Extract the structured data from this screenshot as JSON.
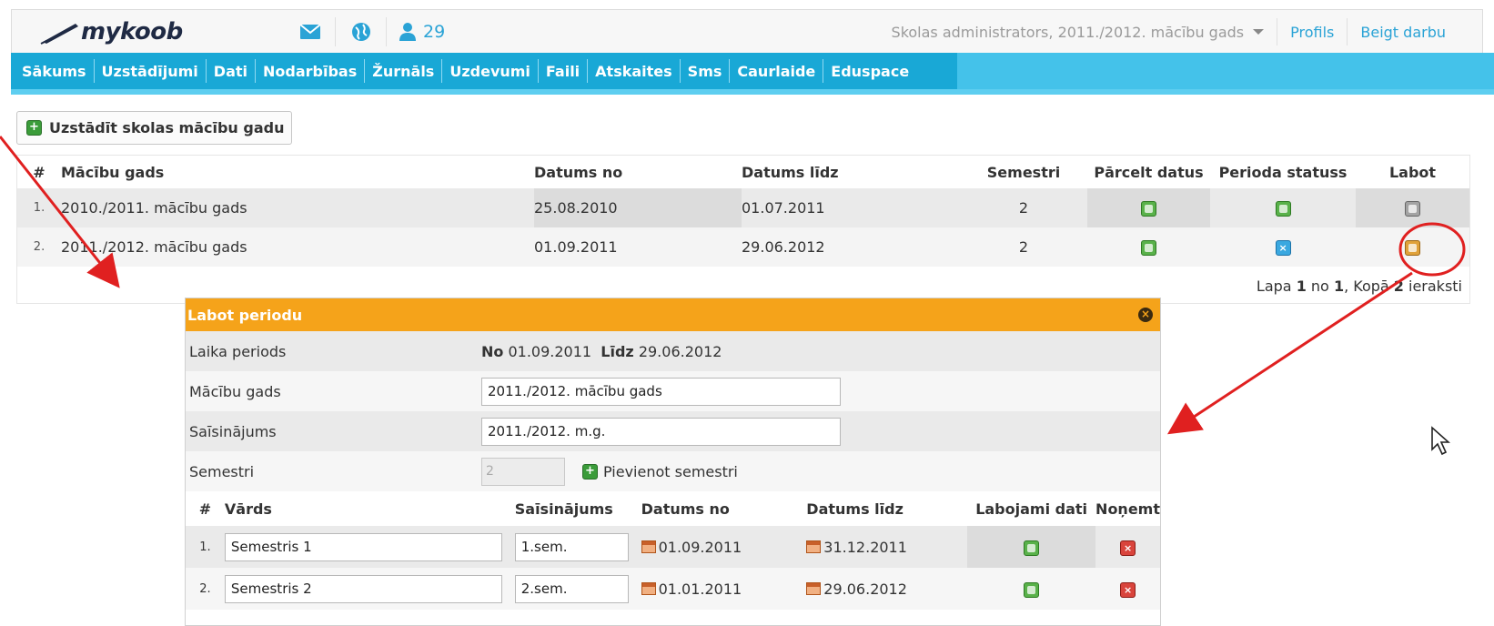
{
  "header": {
    "logo_text": "mykoob",
    "users_count": "29",
    "role": "Skolas administrators, 2011./2012. mācību gads",
    "links": [
      "Profils",
      "Beigt darbu"
    ]
  },
  "nav": {
    "items": [
      "Sākums",
      "Uzstādījumi",
      "Dati",
      "Nodarbības",
      "Žurnāls",
      "Uzdevumi",
      "Faili",
      "Atskaites",
      "Sms",
      "Caurlaide",
      "Eduspace"
    ]
  },
  "main": {
    "set_year_button": "Uzstādīt skolas mācību gadu",
    "columns": [
      "#",
      "Mācību gads",
      "Datums no",
      "Datums līdz",
      "Semestri",
      "Pārcelt datus",
      "Perioda statuss",
      "Labot"
    ],
    "rows": [
      {
        "num": "1.",
        "name": "2010./2011. mācību gads",
        "from": "25.08.2010",
        "to": "01.07.2011",
        "semesters": "2"
      },
      {
        "num": "2.",
        "name": "2011./2012. mācību gads",
        "from": "01.09.2011",
        "to": "29.06.2012",
        "semesters": "2"
      }
    ],
    "pager": {
      "prefix": "Lapa ",
      "page": "1",
      "mid": " no ",
      "pages": "1",
      "mid2": ", Kopā ",
      "total": "2",
      "suffix": " ieraksti"
    }
  },
  "dialog": {
    "title": "Labot periodu",
    "period_label": "Laika periods",
    "period_from_label": "No",
    "period_from": "01.09.2011",
    "period_to_label": "Līdz",
    "period_to": "29.06.2012",
    "year_label": "Mācību gads",
    "year_value": "2011./2012. mācību gads",
    "short_label": "Saīsinājums",
    "short_value": "2011./2012. m.g.",
    "semesters_label": "Semestri",
    "semesters_value": "2",
    "add_semester": "Pievienot semestri",
    "columns": [
      "#",
      "Vārds",
      "Saīsinājums",
      "Datums no",
      "Datums līdz",
      "Labojami dati",
      "Noņemt"
    ],
    "rows": [
      {
        "num": "1.",
        "name": "Semestris 1",
        "short": "1.sem.",
        "from": "01.09.2011",
        "to": "31.12.2011"
      },
      {
        "num": "2.",
        "name": "Semestris 2",
        "short": "2.sem.",
        "from": "01.01.2011",
        "to": "29.06.2012"
      }
    ]
  },
  "colors": {
    "nav_dark": "#19a8d6",
    "nav_light": "#44c2ea",
    "dialog_title": "#f5a31a",
    "annotation": "#e02020"
  }
}
